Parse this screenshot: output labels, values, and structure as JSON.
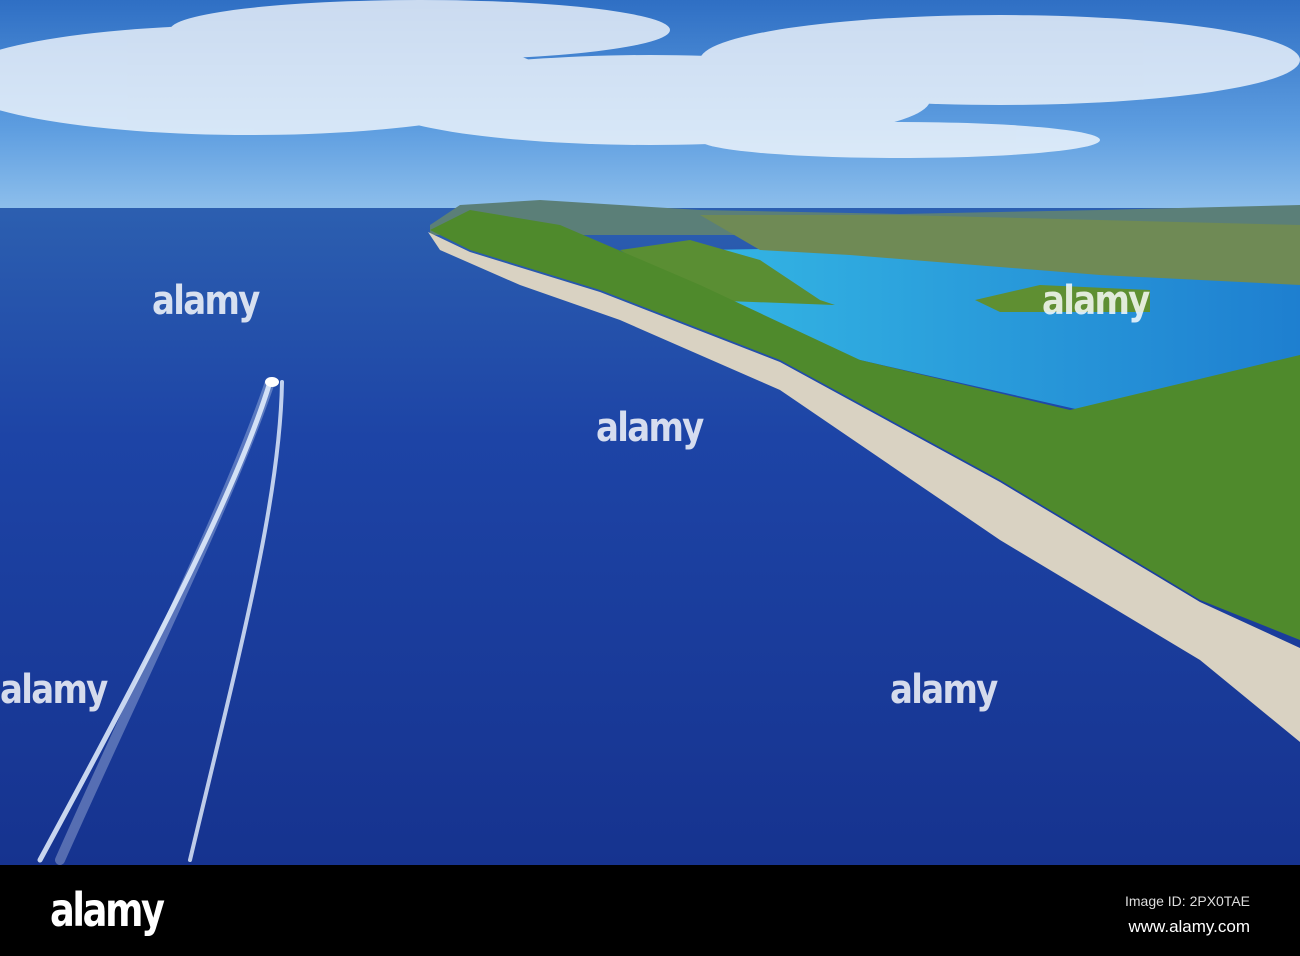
{
  "watermark": {
    "text": "alamy"
  },
  "footer": {
    "logo": "alamy",
    "image_id": "Image ID: 2PX0TAE",
    "website": "www.alamy.com"
  },
  "colors": {
    "sky": "#3f86d6",
    "sea": "#1a3f9c",
    "bay": "#2ea6e0",
    "forest": "#4f8a2c",
    "cliff": "#d9d2c2"
  }
}
